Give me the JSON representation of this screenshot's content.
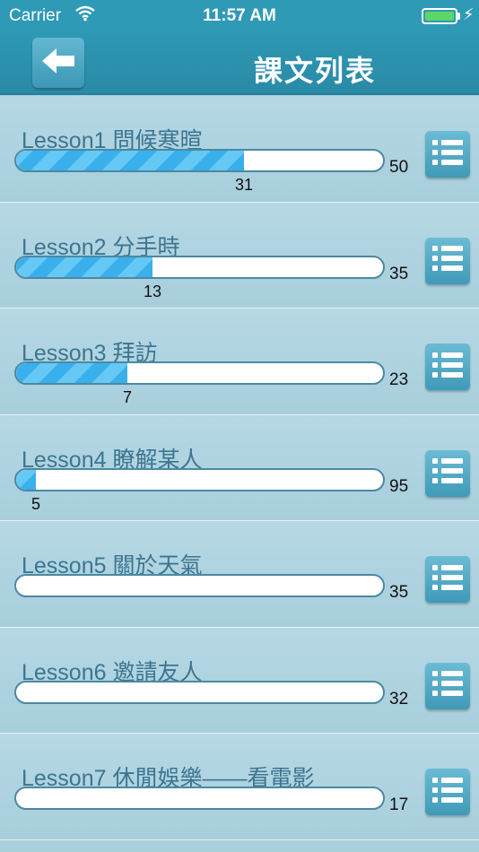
{
  "status_bar": {
    "carrier": "Carrier",
    "time": "11:57 AM",
    "battery_color": "#5cd664"
  },
  "nav": {
    "title": "課文列表",
    "back_icon": "left-arrow-icon"
  },
  "lessons": [
    {
      "title": "Lesson1 問候寒暄",
      "current": "31",
      "total": "50",
      "progress": 0.62
    },
    {
      "title": "Lesson2 分手時",
      "current": "13",
      "total": "35",
      "progress": 0.371
    },
    {
      "title": "Lesson3 拜訪",
      "current": "7",
      "total": "23",
      "progress": 0.304
    },
    {
      "title": "Lesson4 瞭解某人",
      "current": "5",
      "total": "95",
      "progress": 0.053
    },
    {
      "title": "Lesson5 關於天氣",
      "current": "",
      "total": "35",
      "progress": 0
    },
    {
      "title": "Lesson6 邀請友人",
      "current": "",
      "total": "32",
      "progress": 0
    },
    {
      "title": "Lesson7 休閒娛樂——看電影",
      "current": "",
      "total": "17",
      "progress": 0
    }
  ],
  "colors": {
    "accent": "#2f9ab6",
    "progress": "#39b0ec",
    "title_text": "#3d7590"
  }
}
